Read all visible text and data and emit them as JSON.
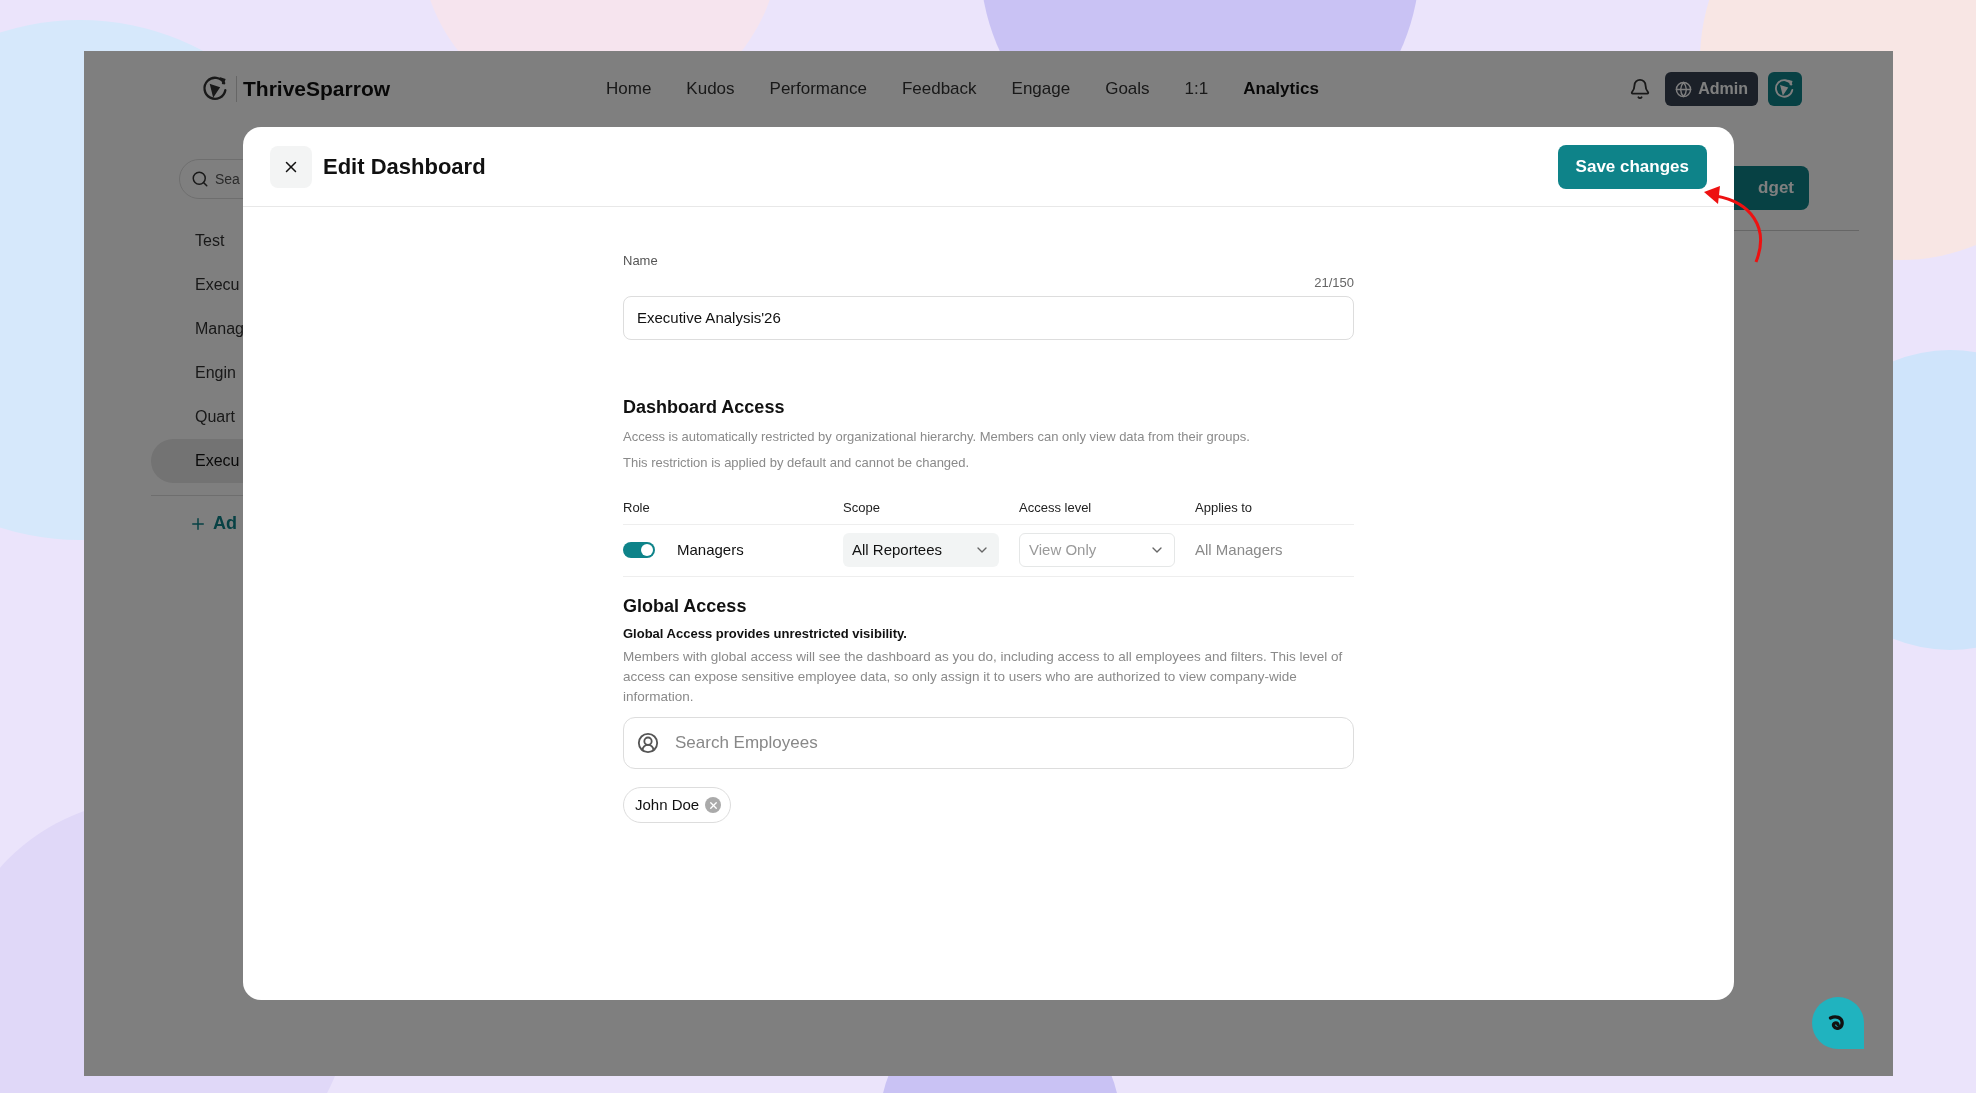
{
  "app": {
    "brand": "ThriveSparrow",
    "nav": [
      {
        "label": "Home",
        "selected": false
      },
      {
        "label": "Kudos",
        "selected": false
      },
      {
        "label": "Performance",
        "selected": false
      },
      {
        "label": "Feedback",
        "selected": false
      },
      {
        "label": "Engage",
        "selected": false
      },
      {
        "label": "Goals",
        "selected": false
      },
      {
        "label": "1:1",
        "selected": false
      },
      {
        "label": "Analytics",
        "selected": true
      }
    ],
    "admin_button": "Admin"
  },
  "sidebar": {
    "search_placeholder": "Sea",
    "items": [
      {
        "label": "Test",
        "selected": false
      },
      {
        "label": "Execu",
        "selected": false
      },
      {
        "label": "Manag",
        "selected": false
      },
      {
        "label": "Engin",
        "selected": false
      },
      {
        "label": "Quart",
        "selected": false
      },
      {
        "label": "Execu",
        "selected": true
      }
    ],
    "add_link": "Ad"
  },
  "background_button": "dget",
  "modal": {
    "title": "Edit Dashboard",
    "save_button": "Save changes",
    "name_field": {
      "label": "Name",
      "counter": "21/150",
      "value": "Executive Analysis'26"
    },
    "dashboard_access": {
      "title": "Dashboard Access",
      "description": [
        "Access is automatically restricted by organizational hierarchy. Members can only view data from their groups.",
        "This restriction is applied by default and cannot be changed."
      ],
      "columns": [
        "Role",
        "Scope",
        "Access level",
        "Applies to"
      ],
      "rows": [
        {
          "role": "Managers",
          "on": true,
          "scope": {
            "value": "All Reportees",
            "disabled": false
          },
          "access_level": {
            "value": "View Only",
            "disabled": true
          },
          "applies_to": "All Managers"
        }
      ]
    },
    "global_access": {
      "title": "Global Access",
      "subtitle": "Global Access provides unrestricted visibility.",
      "description": "Members with global access will see the dashboard as you do, including access to all employees and filters. This level of access can expose sensitive employee data, so only assign it to users who are authorized to view company-wide information.",
      "search": {
        "placeholder": "Search Employees"
      },
      "chips": [
        {
          "label": "John Doe"
        }
      ]
    }
  }
}
